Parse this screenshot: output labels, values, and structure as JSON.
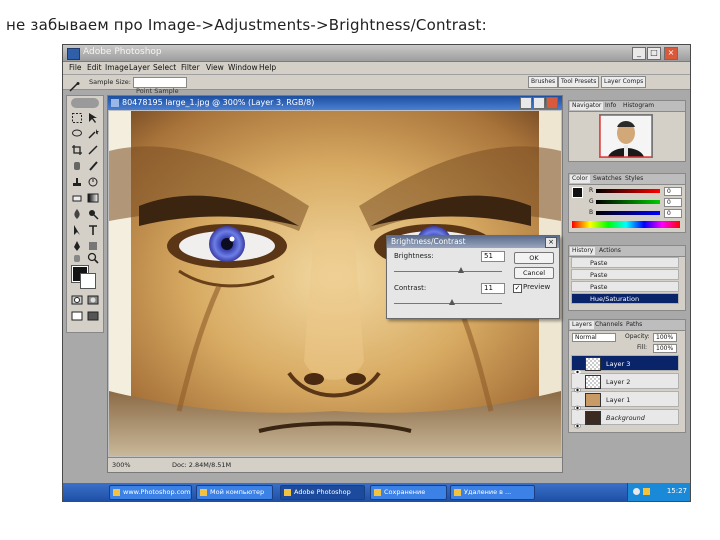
{
  "caption": "не забываем про Image->Adjustments->Brightness/Contrast:",
  "app": {
    "title": "Adobe Photoshop",
    "window_buttons": [
      "_",
      "□",
      "×"
    ]
  },
  "menu": [
    "File",
    "Edit",
    "Image",
    "Layer",
    "Select",
    "Filter",
    "View",
    "Window",
    "Help"
  ],
  "options_bar": {
    "sample_label": "Sample Size:",
    "sample_value": "Point Sample",
    "wells": [
      "Brushes",
      "Tool Presets",
      "Layer Comps"
    ]
  },
  "document": {
    "title": "80478195 large_1.jpg @ 300% (Layer 3, RGB/8)",
    "status_zoom": "300%",
    "status_doc": "Doc: 2.84M/8.51M"
  },
  "dialog": {
    "title": "Brightness/Contrast",
    "brightness_label": "Brightness:",
    "brightness_value": "51",
    "contrast_label": "Contrast:",
    "contrast_value": "11",
    "ok_label": "OK",
    "cancel_label": "Cancel",
    "preview_label": "Preview",
    "preview_checked": true,
    "brightness_fraction": 0.62,
    "contrast_fraction": 0.54
  },
  "navigator": {
    "tabs": [
      "Navigator",
      "Info",
      "Histogram"
    ]
  },
  "color_panel": {
    "tabs": [
      "Color",
      "Swatches",
      "Styles"
    ],
    "channels": [
      "R",
      "G",
      "B"
    ],
    "values": [
      "0",
      "0",
      "0"
    ]
  },
  "history": {
    "tabs": [
      "History",
      "Actions"
    ],
    "items": [
      "Paste",
      "Paste",
      "Paste",
      "Hue/Saturation"
    ]
  },
  "layers": {
    "tabs": [
      "Layers",
      "Channels",
      "Paths"
    ],
    "blend": "Normal",
    "opacity_label": "Opacity:",
    "opacity": "100%",
    "fill_label": "Fill:",
    "fill": "100%",
    "items": [
      "Layer 3",
      "Layer 2",
      "Layer 1",
      "Background"
    ]
  },
  "taskbar": {
    "items": [
      "www.Photoshop.com",
      "Мой компьютер",
      "Adobe Photoshop",
      "Сохранение (Вставка)",
      "Удаление в ..."
    ],
    "clock": "15:27"
  },
  "colors": {
    "titlebar_active": "#1d4fa0",
    "selection": "#0a246a",
    "taskbar": "#1f50a6"
  }
}
